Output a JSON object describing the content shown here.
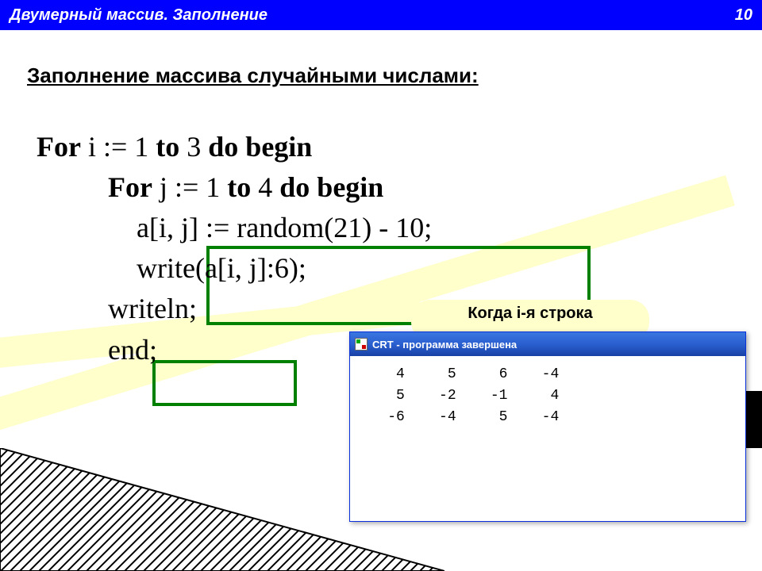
{
  "header": {
    "title": "Двумерный массив. Заполнение",
    "page_number": "10"
  },
  "section_title": "Заполнение массива случайными числами:",
  "code_lines": {
    "l1a": "For",
    "l1b": " i := 1 ",
    "l1c": "to",
    "l1d": " 3 ",
    "l1e": "do begin",
    "l2a": "          For",
    "l2b": " j := 1 ",
    "l2c": "to",
    "l2d": " 4 ",
    "l2e": "do begin",
    "l3": "              a[i, j] := random(21) - 10;",
    "l4": "              write(a[i, j]:6);",
    "l5": "          writeln;",
    "l6": "          end;"
  },
  "callout_text": "Когда i-я строка",
  "crt": {
    "title": "CRT - программа завершена",
    "rows": [
      "     4     5     6    -4",
      "     5    -2    -1     4",
      "    -6    -4     5    -4"
    ]
  }
}
